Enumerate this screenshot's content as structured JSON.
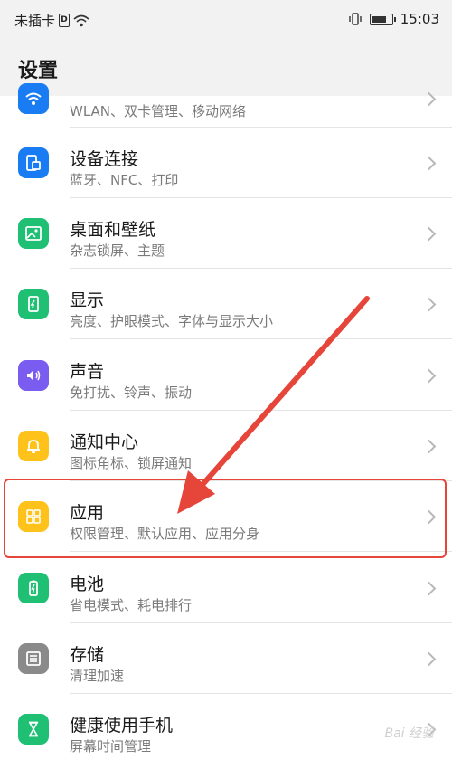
{
  "status_bar": {
    "carrier": "未插卡",
    "sim_icon_label": "D",
    "time": "15:03",
    "battery_level": 0.75
  },
  "header": {
    "title": "设置"
  },
  "rows": [
    {
      "id": "wlan",
      "title": "",
      "subtitle": "WLAN、双卡管理、移动网络",
      "icon": "wifi-icon",
      "color": "#1a7cf2"
    },
    {
      "id": "device",
      "title": "设备连接",
      "subtitle": "蓝牙、NFC、打印",
      "icon": "device-connect-icon",
      "color": "#1a7cf2"
    },
    {
      "id": "desktop",
      "title": "桌面和壁纸",
      "subtitle": "杂志锁屏、主题",
      "icon": "wallpaper-icon",
      "color": "#1fbf74"
    },
    {
      "id": "display",
      "title": "显示",
      "subtitle": "亮度、护眼模式、字体与显示大小",
      "icon": "display-icon",
      "color": "#1fbf74"
    },
    {
      "id": "sound",
      "title": "声音",
      "subtitle": "免打扰、铃声、振动",
      "icon": "speaker-icon",
      "color": "#7a5cf0"
    },
    {
      "id": "notify",
      "title": "通知中心",
      "subtitle": "图标角标、锁屏通知",
      "icon": "bell-icon",
      "color": "#ffc21a"
    },
    {
      "id": "apps",
      "title": "应用",
      "subtitle": "权限管理、默认应用、应用分身",
      "icon": "apps-grid-icon",
      "color": "#ffc21a"
    },
    {
      "id": "battery",
      "title": "电池",
      "subtitle": "省电模式、耗电排行",
      "icon": "battery-icon",
      "color": "#1fbf74"
    },
    {
      "id": "storage",
      "title": "存储",
      "subtitle": "清理加速",
      "icon": "storage-icon",
      "color": "#8a8a8a"
    },
    {
      "id": "health",
      "title": "健康使用手机",
      "subtitle": "屏幕时间管理",
      "icon": "hourglass-icon",
      "color": "#1fbf74"
    }
  ],
  "watermark": "Bai 经验"
}
